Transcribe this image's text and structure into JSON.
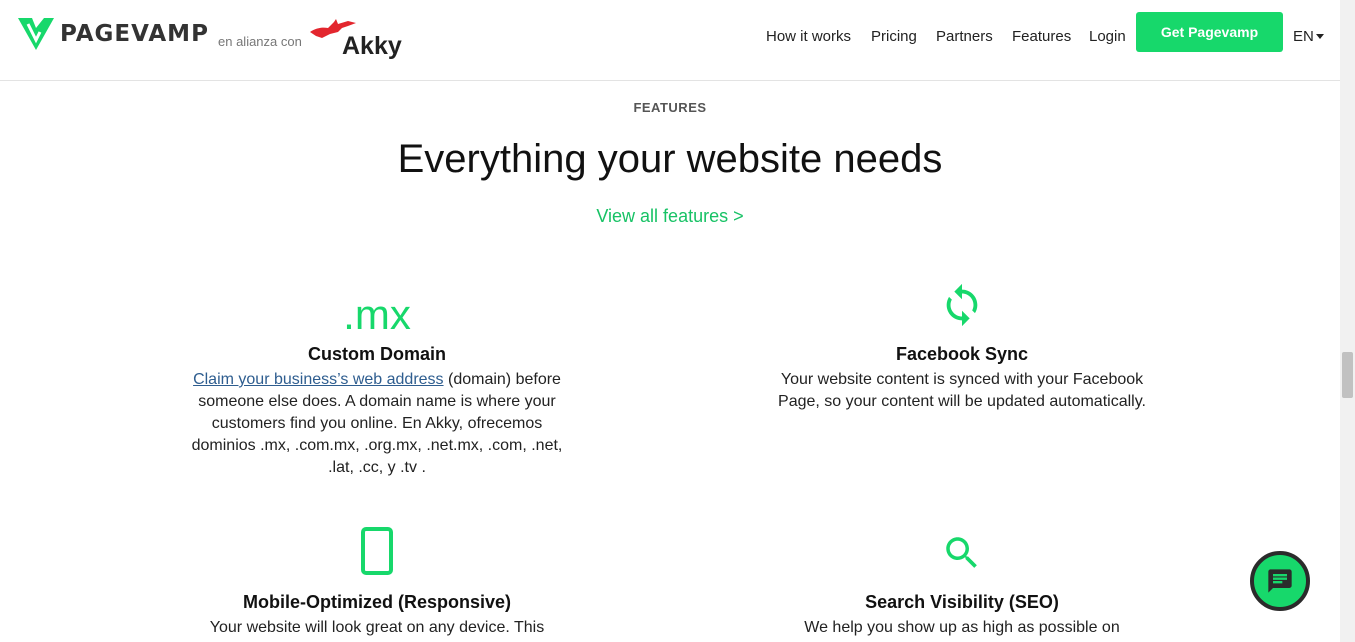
{
  "header": {
    "logo_text": "PAGEVAMP",
    "alliance_text": "en alianza con",
    "partner_name": "Akky",
    "nav": [
      {
        "label": "How it works"
      },
      {
        "label": "Pricing"
      },
      {
        "label": "Partners"
      },
      {
        "label": "Features"
      },
      {
        "label": "Login"
      }
    ],
    "cta_label": "Get Pagevamp",
    "language": "EN"
  },
  "section": {
    "eyebrow": "FEATURES",
    "headline": "Everything your website needs",
    "view_all": "View all features >"
  },
  "features": [
    {
      "badge": ".mx",
      "title": "Custom Domain",
      "link_text": "Claim your business’s web address",
      "desc": " (domain) before someone else does. A domain name is where your customers find you online. En Akky, ofrecemos dominios .mx, .com.mx, .org.mx, .net.mx, .com, .net, .lat, .cc, y .tv ."
    },
    {
      "icon": "sync-icon",
      "title": "Facebook Sync",
      "desc": "Your website content is synced with your Facebook Page, so your content will be updated automatically."
    },
    {
      "icon": "smartphone-icon",
      "title": "Mobile-Optimized (Responsive)",
      "desc": "Your website will look great on any device. This"
    },
    {
      "icon": "search-icon",
      "title": "Search Visibility (SEO)",
      "desc": "We help you show up as high as possible on"
    }
  ],
  "colors": {
    "brand_green": "#17d86b",
    "link_blue": "#2e5d8f",
    "partner_red": "#e3262e"
  }
}
